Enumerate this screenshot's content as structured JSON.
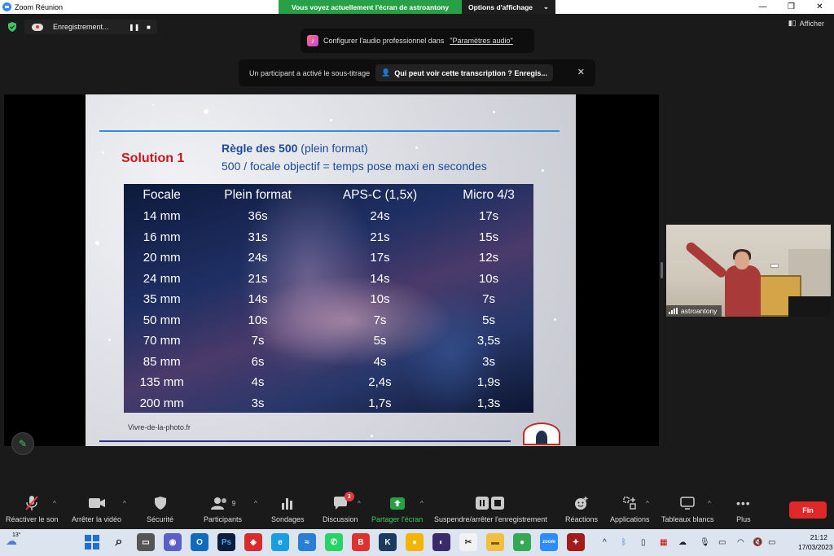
{
  "titlebar": {
    "title": "Zoom Réunion"
  },
  "share_banner": {
    "status": "Vous voyez actuellement l'écran de astroantony",
    "options": "Options d'affichage"
  },
  "recording": {
    "label": "Enregistrement..."
  },
  "view": {
    "label": "Afficher"
  },
  "audio_notice": {
    "text": "Configurer l'audio professionnel dans",
    "link": "\"Paramètres audio\""
  },
  "subtitle_notice": {
    "text": "Un participant a activé le sous-titrage",
    "button": "Qui peut voir cette transcription ? Enregis..."
  },
  "slide": {
    "solution": "Solution 1",
    "rule_title_bold": "Règle des 500",
    "rule_title_rest": " (plein format)",
    "rule_sub": "500 / focale objectif = temps pose maxi en secondes",
    "source": "Vivre-de-la-photo.fr",
    "table": {
      "headers": [
        "Focale",
        "Plein format",
        "APS-C (1,5x)",
        "Micro 4/3"
      ],
      "rows": [
        [
          "14 mm",
          "36s",
          "24s",
          "17s"
        ],
        [
          "16 mm",
          "31s",
          "21s",
          "15s"
        ],
        [
          "20 mm",
          "24s",
          "17s",
          "12s"
        ],
        [
          "24 mm",
          "21s",
          "14s",
          "10s"
        ],
        [
          "35 mm",
          "14s",
          "10s",
          "7s"
        ],
        [
          "50 mm",
          "10s",
          "7s",
          "5s"
        ],
        [
          "70 mm",
          "7s",
          "5s",
          "3,5s"
        ],
        [
          "85 mm",
          "6s",
          "4s",
          "3s"
        ],
        [
          "135 mm",
          "4s",
          "2,4s",
          "1,9s"
        ],
        [
          "200 mm",
          "3s",
          "1,7s",
          "1,3s"
        ]
      ]
    }
  },
  "video": {
    "participant": "astroantony"
  },
  "toolbar": {
    "unmute": "Réactiver le son",
    "stop_video": "Arrêter la vidéo",
    "security": "Sécurité",
    "participants": "Participants",
    "participants_count": "9",
    "polls": "Sondages",
    "chat": "Discussion",
    "chat_badge": "3",
    "share": "Partager l'écran",
    "pause_record": "Suspendre/arrêter l'enregistrement",
    "reactions": "Réactions",
    "apps": "Applications",
    "whiteboards": "Tableaux blancs",
    "more": "Plus",
    "end": "Fin"
  },
  "taskbar": {
    "weather_temp": "13°",
    "time": "21:12",
    "date": "17/03/2023",
    "colors": {
      "accent_green": "#27a046",
      "end_red": "#e02828"
    }
  }
}
